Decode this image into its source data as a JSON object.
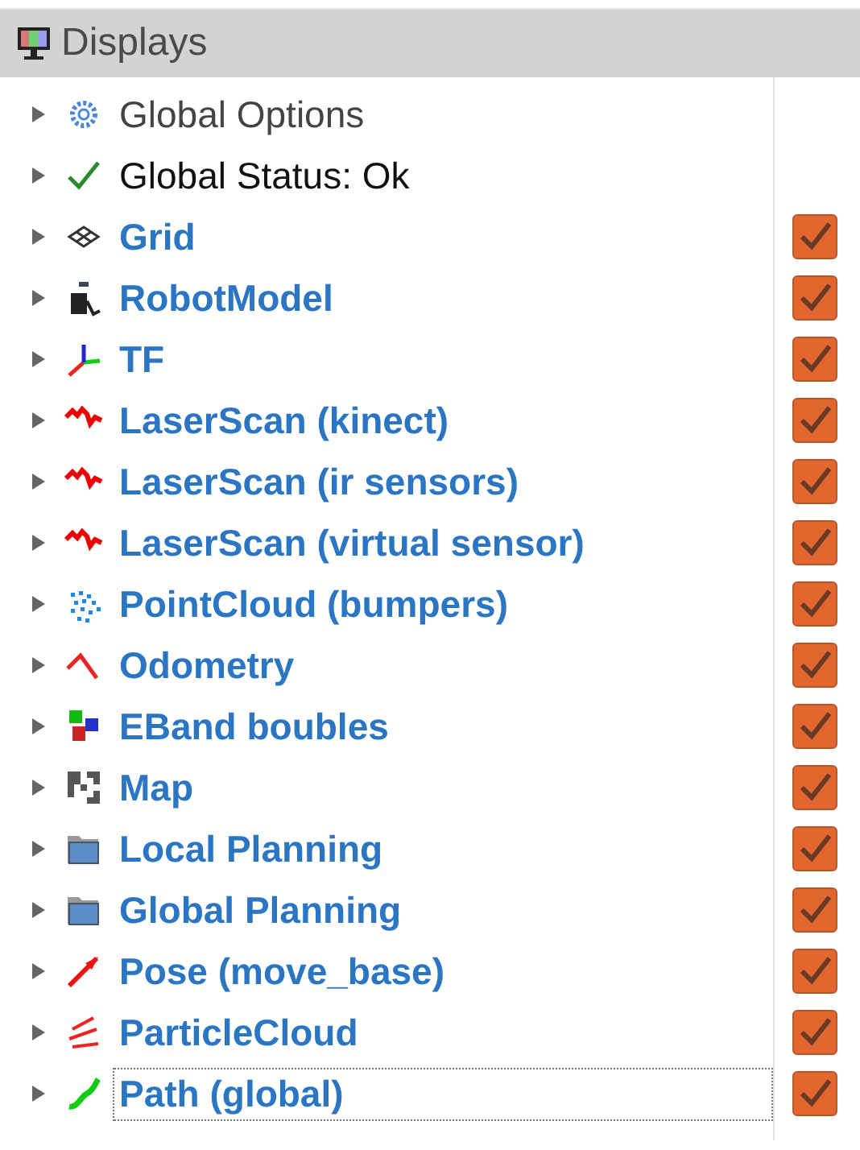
{
  "panel": {
    "title": "Displays"
  },
  "items": [
    {
      "label": "Global Options",
      "kind": "option",
      "expanded": false,
      "selected": false
    },
    {
      "label": "Global Status: Ok",
      "kind": "status",
      "expanded": false,
      "selected": false
    },
    {
      "label": "Grid",
      "kind": "display",
      "expanded": false,
      "selected": false,
      "checked": true
    },
    {
      "label": "RobotModel",
      "kind": "display",
      "expanded": false,
      "selected": false,
      "checked": true
    },
    {
      "label": "TF",
      "kind": "display",
      "expanded": false,
      "selected": false,
      "checked": true
    },
    {
      "label": "LaserScan (kinect)",
      "kind": "display",
      "expanded": false,
      "selected": false,
      "checked": true
    },
    {
      "label": "LaserScan (ir sensors)",
      "kind": "display",
      "expanded": false,
      "selected": false,
      "checked": true
    },
    {
      "label": "LaserScan (virtual sensor)",
      "kind": "display",
      "expanded": false,
      "selected": false,
      "checked": true
    },
    {
      "label": "PointCloud (bumpers)",
      "kind": "display",
      "expanded": false,
      "selected": false,
      "checked": true
    },
    {
      "label": "Odometry",
      "kind": "display",
      "expanded": false,
      "selected": false,
      "checked": true
    },
    {
      "label": "EBand boubles",
      "kind": "display",
      "expanded": false,
      "selected": false,
      "checked": true
    },
    {
      "label": "Map",
      "kind": "display",
      "expanded": false,
      "selected": false,
      "checked": true
    },
    {
      "label": "Local Planning",
      "kind": "display",
      "expanded": false,
      "selected": false,
      "checked": true
    },
    {
      "label": "Global Planning",
      "kind": "display",
      "expanded": false,
      "selected": false,
      "checked": true
    },
    {
      "label": "Pose (move_base)",
      "kind": "display",
      "expanded": false,
      "selected": false,
      "checked": true
    },
    {
      "label": "ParticleCloud",
      "kind": "display",
      "expanded": false,
      "selected": false,
      "checked": true
    },
    {
      "label": "Path (global)",
      "kind": "display",
      "expanded": false,
      "selected": true,
      "checked": true
    }
  ]
}
